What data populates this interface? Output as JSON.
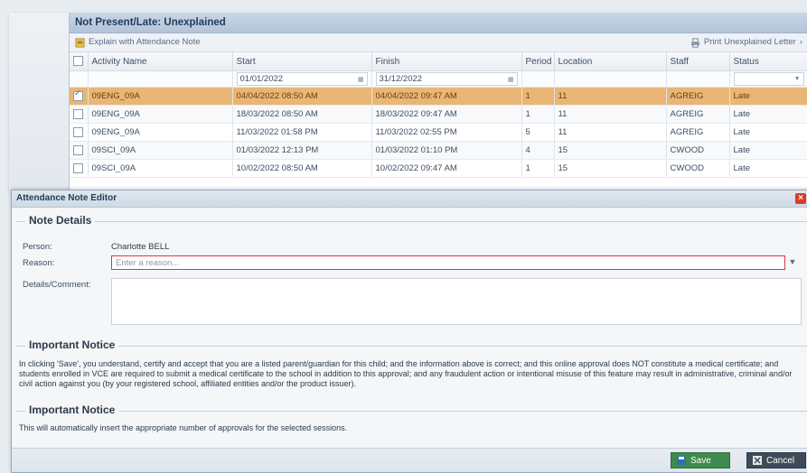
{
  "grid": {
    "title": "Not Present/Late: Unexplained",
    "toolbar": {
      "explain_label": "Explain with Attendance Note",
      "print_label": "Print Unexplained Letter"
    },
    "columns": [
      "Activity Name",
      "Start",
      "Finish",
      "Period",
      "Location",
      "Staff",
      "Status"
    ],
    "filters": {
      "start": "01/01/2022",
      "finish": "31/12/2022"
    },
    "rows": [
      {
        "checked": true,
        "activity": "09ENG_09A",
        "start": "04/04/2022 08:50 AM",
        "finish": "04/04/2022 09:47 AM",
        "period": "1",
        "location": "11",
        "staff": "AGREIG",
        "status": "Late"
      },
      {
        "checked": false,
        "activity": "09ENG_09A",
        "start": "18/03/2022 08:50 AM",
        "finish": "18/03/2022 09:47 AM",
        "period": "1",
        "location": "11",
        "staff": "AGREIG",
        "status": "Late"
      },
      {
        "checked": false,
        "activity": "09ENG_09A",
        "start": "11/03/2022 01:58 PM",
        "finish": "11/03/2022 02:55 PM",
        "period": "5",
        "location": "11",
        "staff": "AGREIG",
        "status": "Late"
      },
      {
        "checked": false,
        "activity": "09SCI_09A",
        "start": "01/03/2022 12:13 PM",
        "finish": "01/03/2022 01:10 PM",
        "period": "4",
        "location": "15",
        "staff": "CWOOD",
        "status": "Late"
      },
      {
        "checked": false,
        "activity": "09SCI_09A",
        "start": "10/02/2022 08:50 AM",
        "finish": "10/02/2022 09:47 AM",
        "period": "1",
        "location": "15",
        "staff": "CWOOD",
        "status": "Late"
      }
    ]
  },
  "dialog": {
    "title": "Attendance Note Editor",
    "note_details": {
      "legend": "Note Details",
      "person_label": "Person:",
      "person_value": "Charlotte BELL",
      "reason_label": "Reason:",
      "reason_placeholder": "Enter a reason...",
      "details_label": "Details/Comment:"
    },
    "notice1": {
      "legend": "Important Notice",
      "text": "In clicking 'Save', you understand, certify and accept that you are a listed parent/guardian for this child; and the information above is correct; and this online approval does NOT constitute a medical certificate; and students enrolled in VCE are required to submit a medical certificate to the school in addition to this approval; and any fraudulent action or intentional misuse of this feature may result in administrative, criminal and/or civil action against you (by your registered school, affiliated entities and/or the product issuer)."
    },
    "notice2": {
      "legend": "Important Notice",
      "text": "This will automatically insert the appropriate number of approvals for the selected sessions."
    },
    "buttons": {
      "save": "Save",
      "cancel": "Cancel"
    }
  },
  "colors": {
    "selected_row": "#e9b675",
    "save": "#3f8a4c",
    "cancel": "#3d4b59",
    "close": "#d93b2b",
    "reason_border": "#d9364a"
  }
}
